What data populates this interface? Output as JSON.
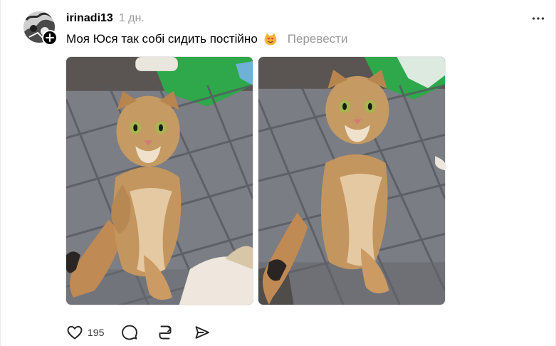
{
  "post": {
    "username": "irinadi13",
    "timestamp": "1 дн.",
    "caption": "Моя Юся так собі сидить постійно",
    "caption_emoji": "smiling-cat-heart-eyes-emoji",
    "translate_label": "Перевести",
    "media": [
      {
        "alt": "photo of a tabby scottish fold cat sitting upright on a checkered blanket"
      },
      {
        "alt": "photo of a tabby scottish fold cat sitting upright on a checkered blanket"
      }
    ]
  },
  "actions": {
    "like_count": "195",
    "icons": [
      "heart-icon",
      "comment-icon",
      "repost-icon",
      "share-icon"
    ]
  },
  "colors": {
    "text": "#000000",
    "muted": "#999999",
    "badge": "#000000",
    "blanket": "#6f7176",
    "cat": "#c89a66",
    "green_mat": "#2fa84a"
  }
}
